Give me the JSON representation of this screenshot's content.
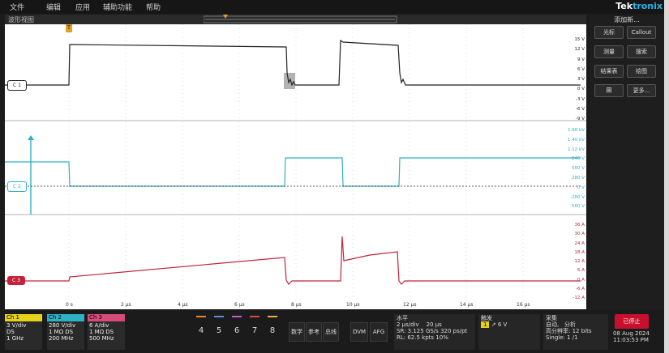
{
  "menu": {
    "file": "文件",
    "edit": "编辑",
    "app": "应用",
    "accessibility": "辅助功能",
    "help": "帮助"
  },
  "brand": {
    "main": "Tek",
    "accent": "tronix"
  },
  "view": {
    "title": "波形视图"
  },
  "channels": {
    "c1": {
      "label": "C 1",
      "color": "#222222"
    },
    "c2": {
      "label": "C 2",
      "color": "#2eb1c4"
    },
    "c3": {
      "label": "C 3",
      "color": "#c0233b"
    }
  },
  "scale_c1": [
    "15 V",
    "12 V",
    "9 V",
    "6 V",
    "3 V",
    "0 V",
    "-3 V",
    "-6 V",
    "-9 V"
  ],
  "scale_c2": [
    "1.68 kV",
    "1.40 kV",
    "1.12 kV",
    "840 V",
    "560 V",
    "280 V",
    "0 V",
    "-280 V",
    "-560 V"
  ],
  "scale_c3": [
    "36 A",
    "30 A",
    "24 A",
    "18 A",
    "12 A",
    "6 A",
    "0 A",
    "-6 A",
    "-12 A"
  ],
  "time_axis": [
    "0 s",
    "2 µs",
    "4 µs",
    "6 µs",
    "8 µs",
    "10 µs",
    "12 µs",
    "14 µs",
    "16 µs"
  ],
  "right_panel": {
    "title": "添加新...",
    "buttons": [
      "光标",
      "Callout",
      "测量",
      "搜索",
      "结果表",
      "绘图",
      "更多..."
    ]
  },
  "ch_badges": [
    {
      "hdr": "Ch 1",
      "l1": "3 V/div",
      "l2": "DS",
      "l3": "1 GHz"
    },
    {
      "hdr": "Ch 2",
      "l1": "280 V/div",
      "l2": "1 MΩ  DS",
      "l3": "200 MHz"
    },
    {
      "hdr": "Ch 3",
      "l1": "6 A/div",
      "l2": "1 MΩ  DS",
      "l3": "500 MHz"
    }
  ],
  "num_buttons": [
    "4",
    "5",
    "6",
    "7",
    "8"
  ],
  "text_buttons": [
    "数学",
    "参考",
    "总线",
    "DVM",
    "AFG"
  ],
  "horizontal": {
    "title": "水平",
    "l1": "2 µs/div",
    "l1b": "20 µs",
    "l2": "SR: 3.125 GS/s",
    "l2b": "320 ps/pt",
    "l3": "RL: 62.5 kpts",
    "l3b": "10%"
  },
  "trigger": {
    "title": "触发",
    "level": "6 V"
  },
  "acquire": {
    "title": "采集",
    "l1": "自动,",
    "l1b": "分析",
    "l2": "高分辨率: 12 bits",
    "l3": "Single: 1 /1"
  },
  "stop": {
    "label": "已停止"
  },
  "datetime": {
    "date": "08 Aug 2024",
    "time": "11:03:53 PM"
  }
}
